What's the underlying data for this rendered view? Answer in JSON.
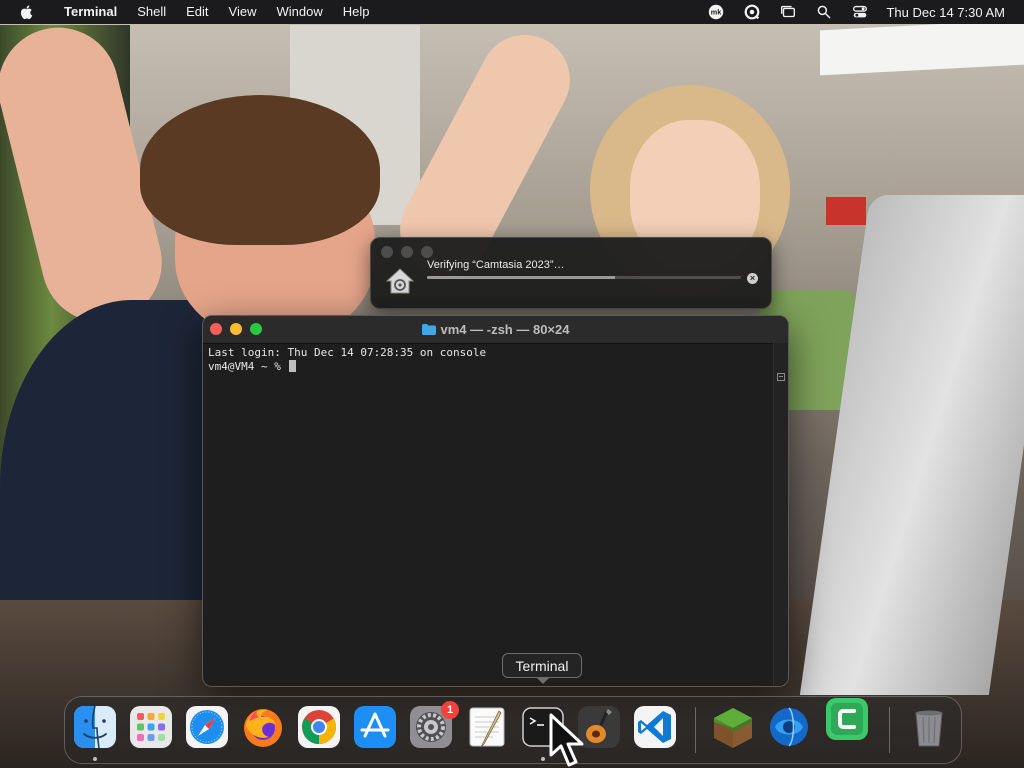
{
  "menubar": {
    "app_name": "Terminal",
    "items": [
      "Shell",
      "Edit",
      "View",
      "Window",
      "Help"
    ],
    "clock": "Thu Dec 14  7:30 AM",
    "status_icons": [
      "mk-icon",
      "screen-record-icon",
      "window-icon",
      "search-icon",
      "control-center-icon"
    ]
  },
  "verify_dialog": {
    "title": "Verifying “Camtasia 2023”…",
    "progress": 0.6,
    "icon": "installer-house-icon"
  },
  "terminal": {
    "title": "vm4 — -zsh — 80×24",
    "lines": [
      "Last login: Thu Dec 14 07:28:35 on console",
      "vm4@VM4 ~ % "
    ]
  },
  "dock": {
    "tooltip": "Terminal",
    "items": [
      {
        "name": "finder",
        "running": true
      },
      {
        "name": "launchpad",
        "running": false
      },
      {
        "name": "safari",
        "running": false
      },
      {
        "name": "firefox",
        "running": false
      },
      {
        "name": "chrome",
        "running": false
      },
      {
        "name": "app-store",
        "running": false
      },
      {
        "name": "system-settings",
        "running": false,
        "badge": "1"
      },
      {
        "name": "textedit",
        "running": false
      },
      {
        "name": "terminal",
        "running": true
      },
      {
        "name": "garageband",
        "running": false
      },
      {
        "name": "vscode",
        "running": false
      },
      {
        "name": "minecraft",
        "running": false
      },
      {
        "name": "blue-app",
        "running": false
      },
      {
        "name": "camtasia",
        "running": false
      },
      {
        "name": "trash",
        "running": false
      }
    ]
  },
  "colors": {
    "menubar_bg": "#1b1b1d",
    "terminal_bg": "#1e1e1e",
    "close": "#fe5f57",
    "minimize": "#febc2e",
    "maximize": "#28c840",
    "badge": "#f2423a"
  }
}
